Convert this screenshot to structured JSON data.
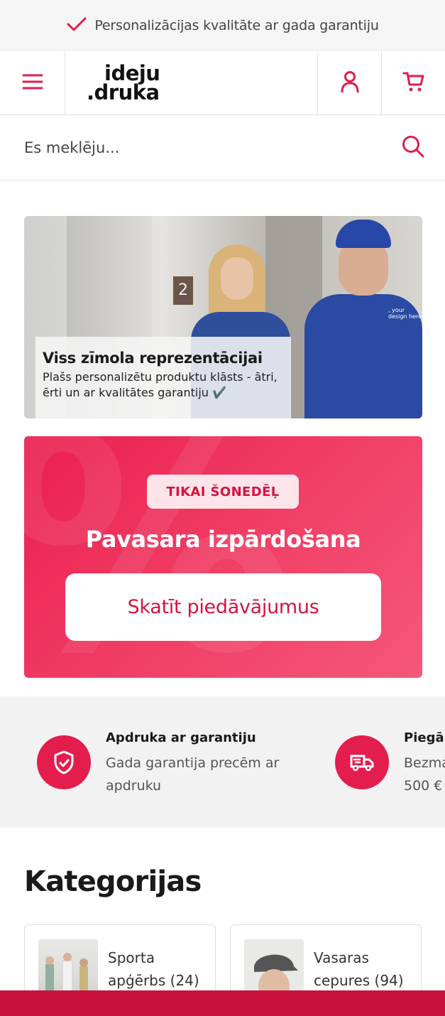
{
  "topbar": {
    "text": "Personalizācijas kvalitāte ar gada garantiju",
    "icon": "check-icon"
  },
  "header": {
    "logo_line1": "ideju",
    "logo_line2": ".druka",
    "icons": [
      "menu-icon",
      "user-icon",
      "cart-icon"
    ]
  },
  "search": {
    "placeholder": "Es meklēju...",
    "icon": "search-icon"
  },
  "hero": {
    "title": "Viss zīmola reprezentācijai",
    "subtitle": "Plašs personalizētu produktu klāsts - ātri, ērti un ar kvalitātes garantiju ✔️",
    "shirt_text": ", your design here",
    "door_number": "2"
  },
  "promo": {
    "badge": "TIKAI ŠONEDĒĻ",
    "title": "Pavasara izpārdošana",
    "button": "Skatīt piedāvājumus"
  },
  "features": [
    {
      "title": "Apdruka ar garantiju",
      "desc": "Gada garantija precēm ar apdruku",
      "icon": "shield-check-icon"
    },
    {
      "title": "Piegā",
      "desc": "Bezma 500 €",
      "icon": "delivery-truck-icon"
    }
  ],
  "categories": {
    "heading": "Kategorijas",
    "items": [
      {
        "label": "Sporta apģērbs (24)"
      },
      {
        "label": "Vasaras cepures (94)"
      }
    ]
  },
  "colors": {
    "accent": "#e31d4c",
    "bottom_bar": "#c8123e"
  }
}
